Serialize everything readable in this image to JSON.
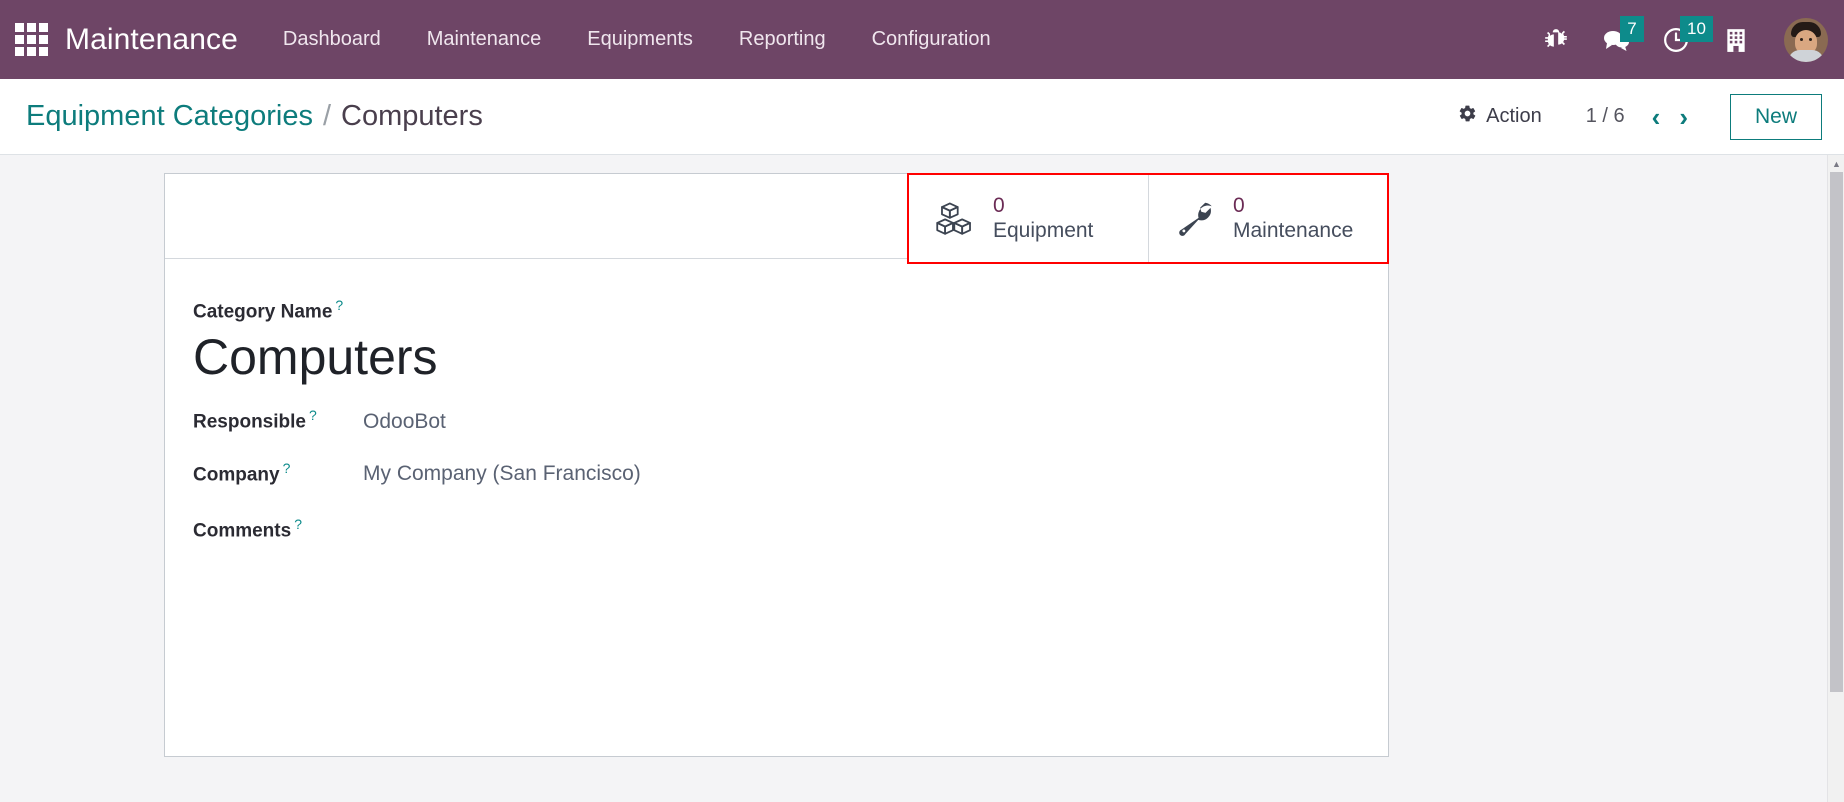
{
  "navbar": {
    "apps_icon": "apps-grid-icon",
    "brand": "Maintenance",
    "menu": [
      {
        "label": "Dashboard"
      },
      {
        "label": "Maintenance"
      },
      {
        "label": "Equipments"
      },
      {
        "label": "Reporting"
      },
      {
        "label": "Configuration"
      }
    ],
    "icons": {
      "bug": "bug-icon",
      "messages": "messages-icon",
      "activities": "clock-icon",
      "company": "building-icon",
      "avatar": "user-avatar"
    },
    "messages_badge": "7",
    "activities_badge": "10",
    "accent_purple": "#6e4566",
    "badge_teal": "#0d8b8b"
  },
  "control_panel": {
    "breadcrumb_parent": "Equipment Categories",
    "breadcrumb_separator": "/",
    "breadcrumb_current": "Computers",
    "action_label": "Action",
    "pager_text": "1 / 6",
    "pager_prev": "‹",
    "pager_next": "›",
    "new_label": "New",
    "teal": "#0d7c7c"
  },
  "stat_buttons": [
    {
      "icon": "cubes-icon",
      "value": "0",
      "label": "Equipment"
    },
    {
      "icon": "wrench-icon",
      "value": "0",
      "label": "Maintenance"
    }
  ],
  "highlight": {
    "color": "#ff0000"
  },
  "form": {
    "category_name": {
      "label": "Category Name",
      "help": "?",
      "value": "Computers"
    },
    "responsible": {
      "label": "Responsible",
      "help": "?",
      "value": "OdooBot"
    },
    "company": {
      "label": "Company",
      "help": "?",
      "value": "My Company (San Francisco)"
    },
    "comments": {
      "label": "Comments",
      "help": "?",
      "value": ""
    }
  },
  "scrollbar": {
    "up_arrow": "▲"
  }
}
